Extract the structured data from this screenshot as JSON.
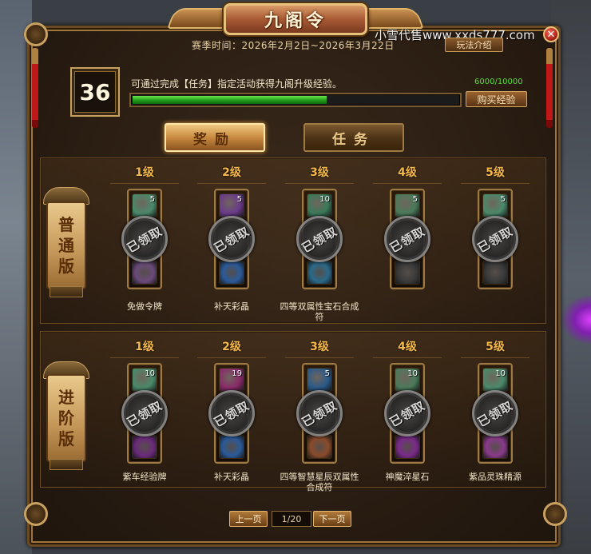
{
  "window": {
    "title": "九阁令",
    "season": "赛季时间：2026年2月2日~2026年3月22日",
    "rules_button": "玩法介绍",
    "watermark": "小雪代售www.xxds777.com",
    "close_symbol": "✕"
  },
  "progress": {
    "level": "36",
    "description": "可通过完成【任务】指定活动获得九阁升级经验。",
    "count_text": "6000/10000",
    "fraction": 0.6,
    "buy_button": "购买经验"
  },
  "tabs": [
    {
      "label": "奖励",
      "active": true
    },
    {
      "label": "任务",
      "active": false
    }
  ],
  "tracks": [
    {
      "label_lines": [
        "普",
        "通",
        "版"
      ],
      "rewards": [
        {
          "level": "1级",
          "top_count": "5",
          "top_color": "#4a8a6a",
          "bot_color": "#6a4a7a",
          "name": "免做令牌",
          "stamp": "已领取"
        },
        {
          "level": "2级",
          "top_count": "5",
          "top_color": "#6a3a8a",
          "bot_color": "#2a5a9a",
          "name": "补天彩晶",
          "stamp": "已领取"
        },
        {
          "level": "3级",
          "top_count": "10",
          "top_color": "#3a7a5a",
          "bot_color": "#2a6a8a",
          "name": "四等双属性宝石合成符",
          "stamp": "已领取"
        },
        {
          "level": "4级",
          "top_count": "5",
          "top_color": "#4a7a5a",
          "bot_color": "#3a3a3a",
          "name": "",
          "stamp": "已领取"
        },
        {
          "level": "5级",
          "top_count": "5",
          "top_color": "#4a8a6a",
          "bot_color": "#3a3a3a",
          "name": "",
          "stamp": "已领取"
        }
      ]
    },
    {
      "label_lines": [
        "进",
        "阶",
        "版"
      ],
      "rewards": [
        {
          "level": "1级",
          "top_count": "10",
          "top_color": "#4a8a6a",
          "bot_color": "#6a2a7a",
          "name": "紫车经验牌",
          "stamp": "已领取"
        },
        {
          "level": "2级",
          "top_count": "19",
          "top_color": "#8a2a6a",
          "bot_color": "#2a5a9a",
          "name": "补天彩晶",
          "stamp": "已领取"
        },
        {
          "level": "3级",
          "top_count": "5",
          "top_color": "#2a5a8a",
          "bot_color": "#8a4a2a",
          "name": "四等智慧星辰双属性合成符",
          "stamp": "已领取"
        },
        {
          "level": "4级",
          "top_count": "10",
          "top_color": "#4a7a5a",
          "bot_color": "#7a2a8a",
          "name": "神魔淬星石",
          "stamp": "已领取"
        },
        {
          "level": "5级",
          "top_count": "10",
          "top_color": "#4a8a6a",
          "bot_color": "#8a3a8a",
          "name": "紫品灵珠精源",
          "stamp": "已领取"
        }
      ]
    }
  ],
  "pager": {
    "prev": "上一页",
    "current": "1/20",
    "next": "下一页"
  }
}
